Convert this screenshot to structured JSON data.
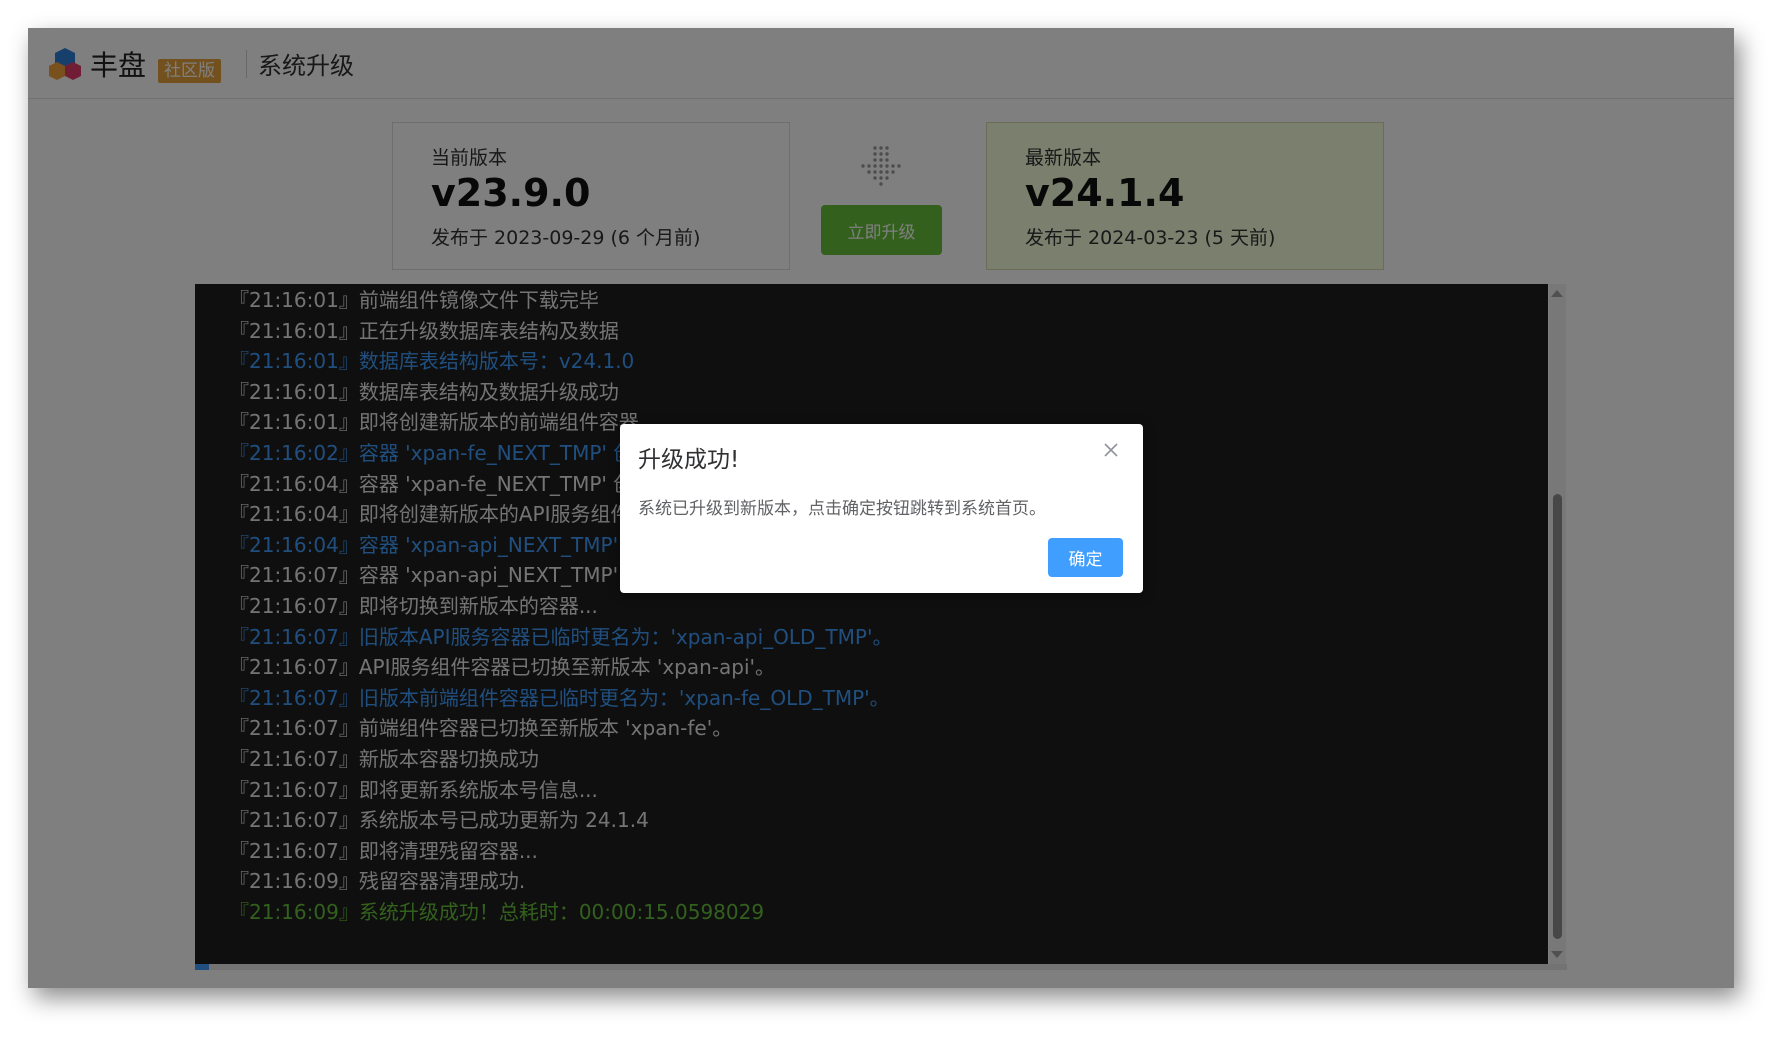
{
  "header": {
    "brand": "丰盘",
    "edition": "社区版",
    "title": "系统升级"
  },
  "current": {
    "label": "当前版本",
    "version": "v23.9.0",
    "released": "发布于 2023-09-29 (6 个月前)"
  },
  "latest": {
    "label": "最新版本",
    "version": "v24.1.4",
    "released": "发布于 2024-03-23 (5 天前)"
  },
  "upgrade_button": "立即升级",
  "log_progress": 0.01,
  "log": [
    {
      "text": "『21:16:01』前端组件镜像文件下载完毕",
      "level": "normal"
    },
    {
      "text": "『21:16:01』正在升级数据库表结构及数据",
      "level": "normal"
    },
    {
      "text": "『21:16:01』数据库表结构版本号：v24.1.0",
      "level": "info"
    },
    {
      "text": "『21:16:01』数据库表结构及数据升级成功",
      "level": "normal"
    },
    {
      "text": "『21:16:01』即将创建新版本的前端组件容器",
      "level": "normal"
    },
    {
      "text": "『21:16:02』容器 'xpan-fe_NEXT_TMP' 创建",
      "level": "info"
    },
    {
      "text": "『21:16:04』容器 'xpan-fe_NEXT_TMP' 创建",
      "level": "normal"
    },
    {
      "text": "『21:16:04』即将创建新版本的API服务组件容",
      "level": "normal"
    },
    {
      "text": "『21:16:04』容器 'xpan-api_NEXT_TMP' 创",
      "level": "info"
    },
    {
      "text": "『21:16:07』容器 'xpan-api_NEXT_TMP' 创",
      "level": "normal"
    },
    {
      "text": "『21:16:07』即将切换到新版本的容器...",
      "level": "normal"
    },
    {
      "text": "『21:16:07』旧版本API服务容器已临时更名为：'xpan-api_OLD_TMP'。",
      "level": "info"
    },
    {
      "text": "『21:16:07』API服务组件容器已切换至新版本 'xpan-api'。",
      "level": "normal"
    },
    {
      "text": "『21:16:07』旧版本前端组件容器已临时更名为：'xpan-fe_OLD_TMP'。",
      "level": "info"
    },
    {
      "text": "『21:16:07』前端组件容器已切换至新版本 'xpan-fe'。",
      "level": "normal"
    },
    {
      "text": "『21:16:07』新版本容器切换成功",
      "level": "normal"
    },
    {
      "text": "『21:16:07』即将更新系统版本号信息...",
      "level": "normal"
    },
    {
      "text": "『21:16:07』系统版本号已成功更新为 24.1.4",
      "level": "normal"
    },
    {
      "text": "『21:16:07』即将清理残留容器...",
      "level": "normal"
    },
    {
      "text": "『21:16:09』残留容器清理成功.",
      "level": "normal"
    },
    {
      "text": "『21:16:09』系统升级成功！总耗时：00:00:15.0598029",
      "level": "success"
    }
  ],
  "dialog": {
    "title": "升级成功!",
    "message": "系统已升级到新版本，点击确定按钮跳转到系统首页。",
    "confirm": "确定"
  },
  "colors": {
    "accent": "#409eff",
    "success": "#67c23a",
    "edition_badge": "#e6a23c",
    "latest_card": "#f7ffdc",
    "log_bg": "#1e1e1e"
  },
  "icons": {
    "logo": "cube-logo-icon",
    "arrow": "dotted-arrow-right-icon",
    "close": "close-icon"
  }
}
